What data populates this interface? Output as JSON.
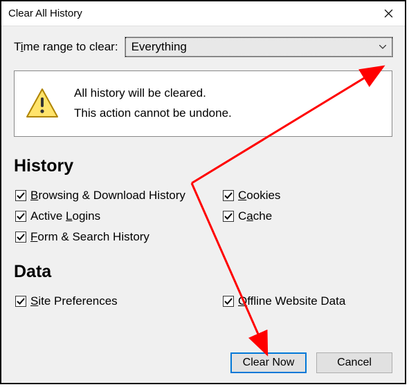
{
  "title": "Clear All History",
  "range": {
    "label_pre": "T",
    "label_ul": "i",
    "label_post": "me range to clear:",
    "selected": "Everything"
  },
  "warning": {
    "line1": "All history will be cleared.",
    "line2": "This action cannot be undone."
  },
  "sections": {
    "history": {
      "title": "History",
      "items": [
        {
          "ul": "B",
          "rest": "rowsing & Download History",
          "checked": true
        },
        {
          "ul": "C",
          "rest": "ookies",
          "checked": true
        },
        {
          "pre": "Active ",
          "ul": "L",
          "rest": "ogins",
          "checked": true
        },
        {
          "pre": "C",
          "ul": "a",
          "rest": "che",
          "checked": true
        },
        {
          "ul": "F",
          "rest": "orm & Search History",
          "checked": true
        }
      ]
    },
    "data": {
      "title": "Data",
      "items": [
        {
          "ul": "S",
          "rest": "ite Preferences",
          "checked": true
        },
        {
          "ul": "O",
          "rest": "ffline Website Data",
          "checked": true
        }
      ]
    }
  },
  "buttons": {
    "clear": "Clear Now",
    "cancel": "Cancel"
  }
}
